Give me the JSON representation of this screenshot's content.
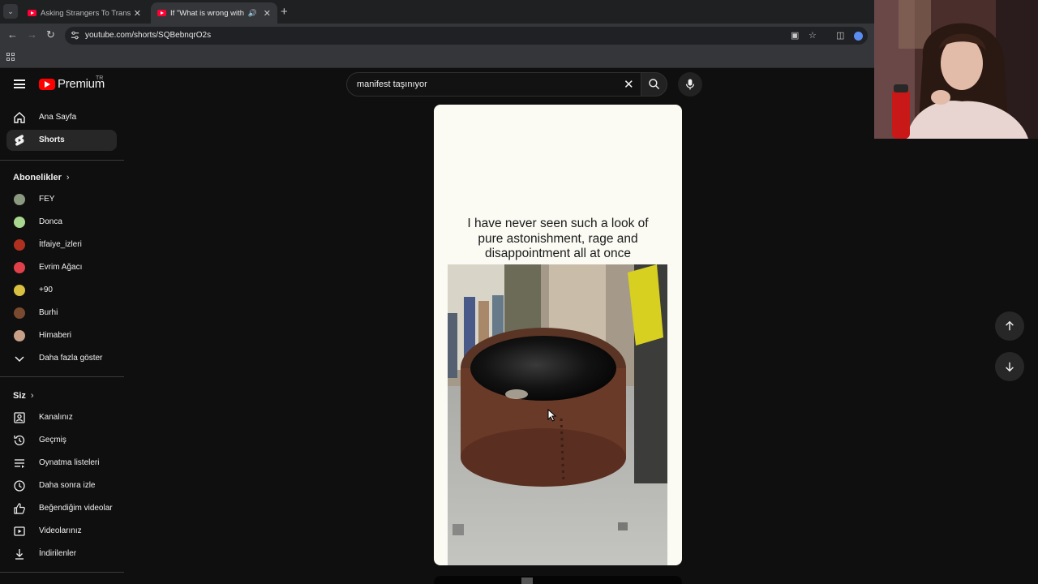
{
  "browser": {
    "tabs": [
      {
        "title": "Asking Strangers To Transform",
        "active": false
      },
      {
        "title": "If \"What is wrong with you\"",
        "active": true
      }
    ],
    "url": "youtube.com/shorts/SQBebnqrO2s"
  },
  "masthead": {
    "logo_text": "Premium",
    "country_code": "TR",
    "search_value": "manifest taşınıyor"
  },
  "sidebar": {
    "main_items": [
      {
        "label": "Ana Sayfa",
        "icon": "home-icon"
      },
      {
        "label": "Shorts",
        "icon": "shorts-icon",
        "active": true
      }
    ],
    "subscriptions_heading": "Abonelikler",
    "subscriptions": [
      {
        "label": "FEY",
        "color": "#8a9a80"
      },
      {
        "label": "Donca",
        "color": "#a8d890"
      },
      {
        "label": "İtfaiye_izleri",
        "color": "#b03020"
      },
      {
        "label": "Evrim Ağacı",
        "color": "#e0404a"
      },
      {
        "label": "+90",
        "color": "#d8c040"
      },
      {
        "label": "Burhi",
        "color": "#7a4a30"
      },
      {
        "label": "Himaberi",
        "color": "#c8a088"
      }
    ],
    "show_more_label": "Daha fazla göster",
    "you_heading": "Siz",
    "you_items": [
      {
        "label": "Kanalınız",
        "icon": "channel-icon"
      },
      {
        "label": "Geçmiş",
        "icon": "history-icon"
      },
      {
        "label": "Oynatma listeleri",
        "icon": "playlists-icon"
      },
      {
        "label": "Daha sonra izle",
        "icon": "watch-later-icon"
      },
      {
        "label": "Beğendiğim videolar",
        "icon": "liked-videos-icon"
      },
      {
        "label": "Videolarınız",
        "icon": "your-videos-icon"
      },
      {
        "label": "İndirilenler",
        "icon": "downloads-icon"
      }
    ]
  },
  "short": {
    "caption_lines": [
      "I have never seen such a look of",
      "pure astonishment, rage and",
      "disappointment all  at once"
    ]
  },
  "colors": {
    "background": "#0f0f0f",
    "youtube_red": "#ff0000",
    "active_item": "#272727"
  }
}
